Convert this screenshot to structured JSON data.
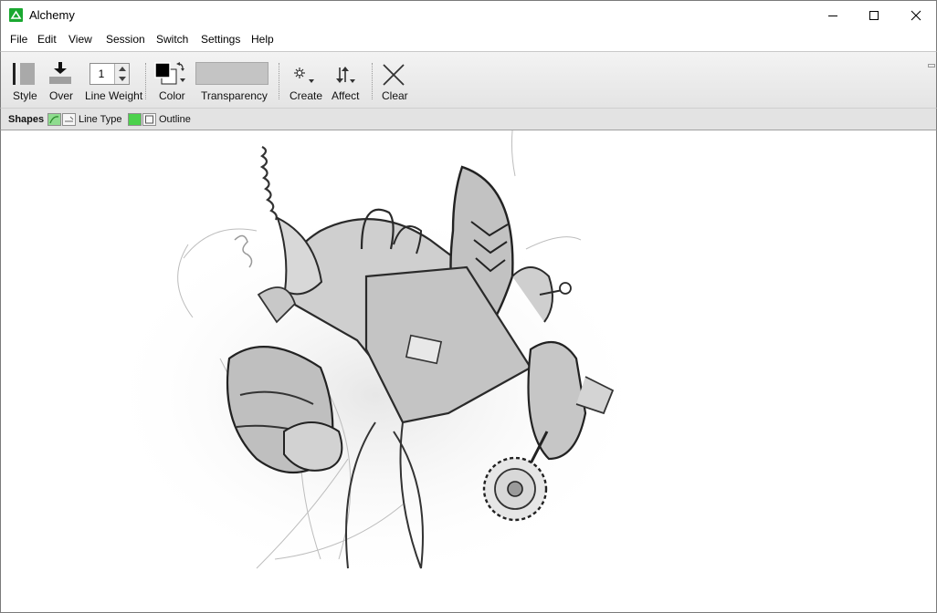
{
  "window": {
    "title": "Alchemy",
    "controls": {
      "minimize": "minimize-icon",
      "maximize": "maximize-icon",
      "close": "close-icon"
    }
  },
  "menu": {
    "items": [
      "File",
      "Edit",
      "View",
      "Session",
      "Switch",
      "Settings",
      "Help"
    ]
  },
  "toolbar": {
    "style_label": "Style",
    "over_label": "Over",
    "line_weight_label": "Line Weight",
    "line_weight_value": "1",
    "color_label": "Color",
    "transparency_label": "Transparency",
    "create_label": "Create",
    "affect_label": "Affect",
    "clear_label": "Clear",
    "colors": {
      "foreground": "#000000",
      "background": "#ffffff",
      "transparency_swatch": "#c4c4c4"
    }
  },
  "shapes_bar": {
    "title": "Shapes",
    "line_type_label": "Line Type",
    "outline_label": "Outline",
    "accent": "#4cd14c"
  },
  "canvas": {
    "content": "sketch",
    "background": "#ffffff"
  }
}
